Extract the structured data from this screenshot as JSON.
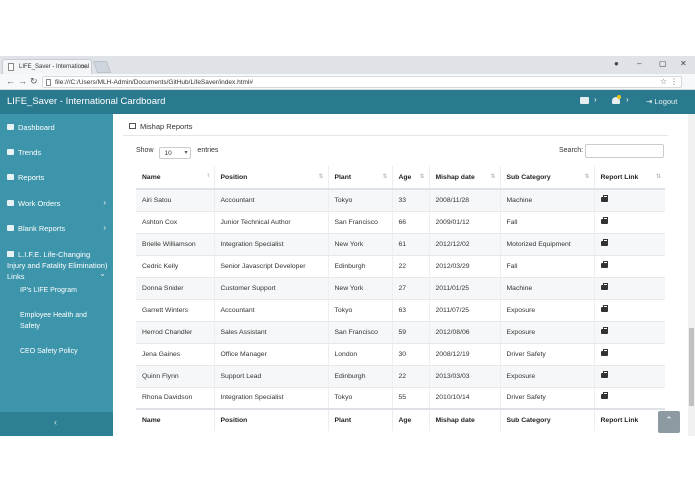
{
  "browser": {
    "tab_title": "LIFE_Saver - International",
    "url": "file:///C:/Users/MLH-Admin/Documents/GitHub/LifeSaver/index.html#"
  },
  "header": {
    "title": "LIFE_Saver - International Cardboard",
    "logout_label": "Logout"
  },
  "sidebar": {
    "items": [
      {
        "label": "Dashboard",
        "icon": "dashboard-icon"
      },
      {
        "label": "Trends",
        "icon": "trends-icon"
      },
      {
        "label": "Reports",
        "icon": "reports-icon"
      },
      {
        "label": "Work Orders",
        "icon": "wrench-icon"
      },
      {
        "label": "Blank Reports",
        "icon": "file-icon"
      }
    ],
    "life_links_label": "L.I.F.E. Life-Changing Injury and Fatality Elimination) Links",
    "sub_items": [
      "IP's LIFE Program",
      "Employee Health and Safety",
      "CEO Safety Policy"
    ],
    "collapse_glyph": "‹"
  },
  "panel": {
    "title": "Mishap Reports",
    "show_label": "Show",
    "entries_value": "10",
    "entries_label": "entries",
    "search_label": "Search:"
  },
  "table": {
    "columns": [
      "Name",
      "Position",
      "Plant",
      "Age",
      "Mishap date",
      "Sub Category",
      "Report Link"
    ],
    "rows": [
      [
        "Airi Satou",
        "Accountant",
        "Tokyo",
        "33",
        "2008/11/28",
        "Machine"
      ],
      [
        "Ashton Cox",
        "Junior Technical Author",
        "San Francisco",
        "66",
        "2009/01/12",
        "Fall"
      ],
      [
        "Brielle Williamson",
        "Integration Specialist",
        "New York",
        "61",
        "2012/12/02",
        "Motorized Equipment"
      ],
      [
        "Cedric Kelly",
        "Senior Javascript Developer",
        "Edinburgh",
        "22",
        "2012/03/29",
        "Fall"
      ],
      [
        "Donna Snider",
        "Customer Support",
        "New York",
        "27",
        "2011/01/25",
        "Machine"
      ],
      [
        "Garrett Winters",
        "Accountant",
        "Tokyo",
        "63",
        "2011/07/25",
        "Exposure"
      ],
      [
        "Herrod Chandler",
        "Sales Assistant",
        "San Francisco",
        "59",
        "2012/08/06",
        "Exposure"
      ],
      [
        "Jena Gaines",
        "Office Manager",
        "London",
        "30",
        "2008/12/19",
        "Driver Safety"
      ],
      [
        "Quinn Flynn",
        "Support Lead",
        "Edinburgh",
        "22",
        "2013/03/03",
        "Exposure"
      ],
      [
        "Rhona Davidson",
        "Integration Specialist",
        "Tokyo",
        "55",
        "2010/10/14",
        "Driver Safety"
      ]
    ]
  },
  "colors": {
    "header": "#2a7a8f",
    "sidebar": "#3d95ab",
    "sidebar_footer": "#2d7f94"
  }
}
